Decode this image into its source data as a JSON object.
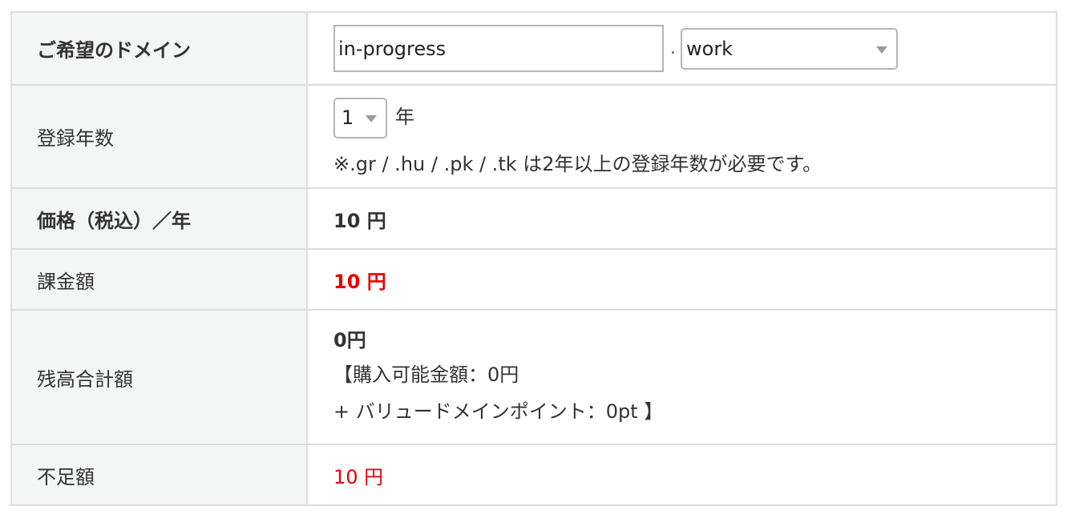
{
  "domain_row": {
    "label": "ご希望のドメイン",
    "input_value": "in-progress",
    "separator": ".",
    "tld_selected": "work"
  },
  "years_row": {
    "label": "登録年数",
    "selected": "1",
    "unit": "年",
    "note": "※.gr / .hu / .pk / .tk は2年以上の登録年数が必要です。"
  },
  "price_row": {
    "label": "価格（税込）／年",
    "value": "10 円"
  },
  "charge_row": {
    "label": "課金額",
    "value": "10 円"
  },
  "balance_row": {
    "label": "残高合計額",
    "total": "0円",
    "purchasable": "【購入可能金額：0円",
    "points": "+ バリュードメインポイント：0pt 】"
  },
  "shortfall_row": {
    "label": "不足額",
    "value": "10 円"
  },
  "colors": {
    "label_bg": "#f4f5f5",
    "border": "#dcdcdc",
    "text": "#333333",
    "alert_red": "#e60000"
  },
  "icons": {
    "select_caret": "triangle-down"
  }
}
